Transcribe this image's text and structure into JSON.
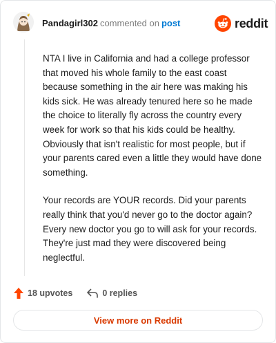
{
  "comment": {
    "username": "Pandagirl302",
    "action_text": "commented on",
    "post_link": "post",
    "paragraphs": [
      "NTA I live in California and had a college professor that moved his whole family to the east coast because something in the air here was making his kids sick. He was already tenured here so he made the choice to literally fly across the country every week for work so that his kids could be healthy. Obviously that isn't realistic for most people, but if your parents cared even a little they would have done something.",
      "Your records are YOUR records. Did your parents really think that you'd never go to the doctor again? Every new doctor you go to will ask for your records. They're just mad they were discovered being neglectful."
    ],
    "upvotes": "18 upvotes",
    "replies": "0 replies"
  },
  "brand": {
    "wordmark": "reddit",
    "accent_color": "#ff4500",
    "link_color": "#d93a00"
  },
  "icons": {
    "logo": "reddit-snoo-icon",
    "upvote": "upvote-arrow-icon",
    "reply": "reply-arrow-icon",
    "avatar": "user-avatar-icon"
  },
  "cta": {
    "label": "View more on Reddit"
  }
}
